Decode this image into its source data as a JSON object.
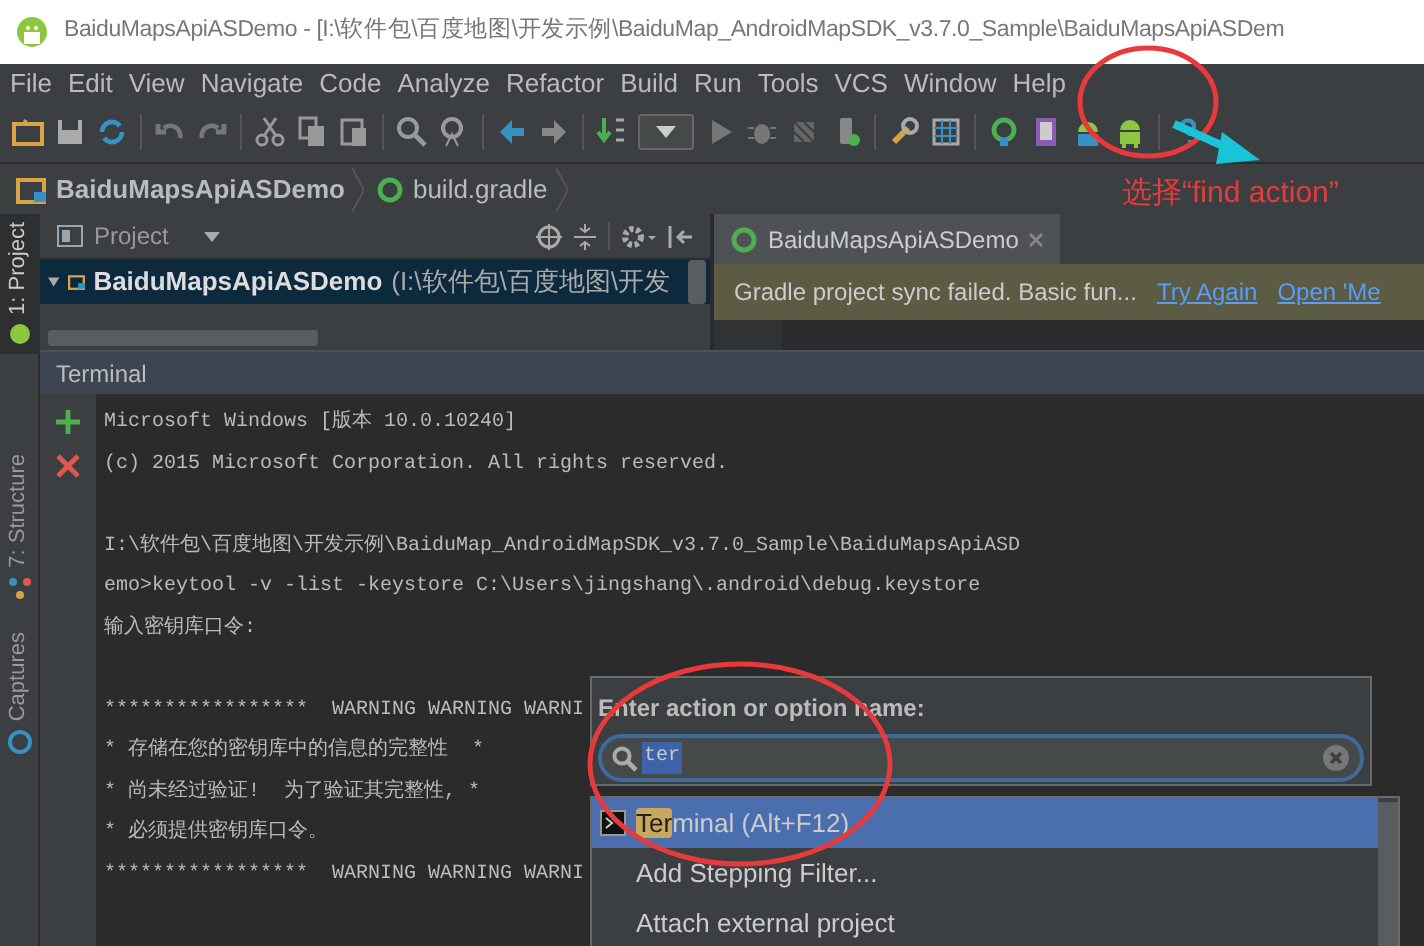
{
  "window": {
    "title": "BaiduMapsApiASDemo - [I:\\软件包\\百度地图\\开发示例\\BaiduMap_AndroidMapSDK_v3.7.0_Sample\\BaiduMapsApiASDem"
  },
  "menu": [
    "File",
    "Edit",
    "View",
    "Navigate",
    "Code",
    "Analyze",
    "Refactor",
    "Build",
    "Run",
    "Tools",
    "VCS",
    "Window",
    "Help"
  ],
  "breadcrumb": [
    {
      "label": "BaiduMapsApiASDemo",
      "kind": "project"
    },
    {
      "label": "build.gradle",
      "kind": "file"
    }
  ],
  "tool_strip": [
    {
      "label": "1: Project",
      "selected": true,
      "kind": "project"
    },
    {
      "label": "7: Structure",
      "selected": false,
      "kind": "structure"
    },
    {
      "label": "Captures",
      "selected": false,
      "kind": "captures"
    }
  ],
  "project_panel": {
    "view": "Project",
    "tree": [
      {
        "name": "BaiduMapsApiASDemo",
        "path": "(I:\\软件包\\百度地图\\开发",
        "expanded": true,
        "selected": true
      }
    ]
  },
  "editor": {
    "tabs": [
      {
        "label": "BaiduMapsApiASDemo",
        "selected": true
      }
    ],
    "notification": {
      "message": "Gradle project sync failed. Basic fun...",
      "links": [
        "Try Again",
        "Open 'Me"
      ]
    }
  },
  "terminal": {
    "title": "Terminal",
    "blocks": [
      {
        "lines": [
          "Microsoft Windows [版本 10.0.10240]",
          "(c) 2015 Microsoft Corporation. All rights reserved."
        ]
      },
      {
        "lines": [
          "I:\\软件包\\百度地图\\开发示例\\BaiduMap_AndroidMapSDK_v3.7.0_Sample\\BaiduMapsApiASD",
          "emo>keytool -v -list -keystore C:\\Users\\jingshang\\.android\\debug.keystore",
          "输入密钥库口令:"
        ]
      },
      {
        "lines": [
          "*****************  WARNING WARNING WARNI",
          "* 存储在您的密钥库中的信息的完整性  *",
          "* 尚未经过验证!  为了验证其完整性, *",
          "* 必须提供密钥库口令。",
          "*****************  WARNING WARNING WARNI"
        ]
      }
    ]
  },
  "find_action": {
    "label": "Enter action or option name:",
    "search": {
      "value": "ter"
    },
    "results": [
      {
        "kind": "terminal",
        "match": "Ter",
        "label": "minal (Alt+F12)",
        "selected": true
      },
      {
        "kind": "action",
        "label": "Add Stepping Filter...",
        "selected": false
      },
      {
        "kind": "action",
        "label": "Attach external project",
        "selected": false
      }
    ]
  },
  "annotation": {
    "text": "选择“find action”"
  }
}
